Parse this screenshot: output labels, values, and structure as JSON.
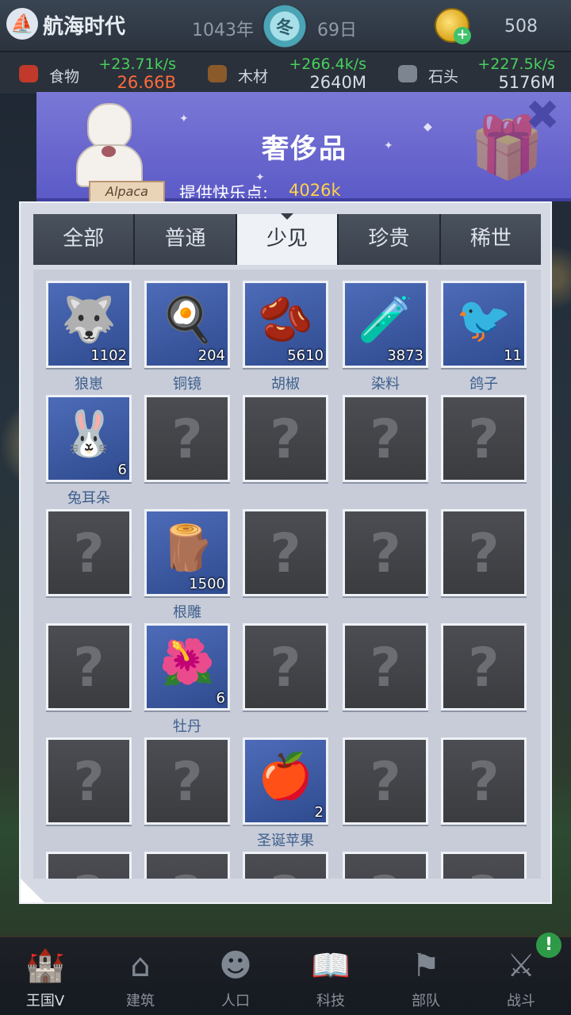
{
  "topbar": {
    "title": "航海时代",
    "year": "1043年",
    "season": "冬",
    "day": "69日",
    "coins": "508"
  },
  "resources": [
    {
      "name": "食物",
      "rate": "+23.71k/s",
      "total": "26.66B",
      "total_color": "#ff6a3a",
      "icon_color": "#c0392b"
    },
    {
      "name": "木材",
      "rate": "+266.4k/s",
      "total": "2640M",
      "total_color": "#d8dee6",
      "icon_color": "#8a5a2b"
    },
    {
      "name": "石头",
      "rate": "+227.5k/s",
      "total": "5176M",
      "total_color": "#d8dee6",
      "icon_color": "#7d8590"
    }
  ],
  "modal": {
    "mascot_sign": "Alpaca",
    "title": "奢侈品",
    "happy_label": "提供快乐点:",
    "happy_value": "4026k",
    "close_icon": "close-icon",
    "tabs": [
      {
        "label": "全部",
        "active": false
      },
      {
        "label": "普通",
        "active": false
      },
      {
        "label": "少见",
        "active": true
      },
      {
        "label": "珍贵",
        "active": false
      },
      {
        "label": "稀世",
        "active": false
      }
    ]
  },
  "items": [
    {
      "name": "狼崽",
      "count": "1102",
      "known": true,
      "icon": "wolf-cub-icon",
      "glyph": "🐺"
    },
    {
      "name": "铜镜",
      "count": "204",
      "known": true,
      "icon": "bronze-mirror-icon",
      "glyph": "🍳"
    },
    {
      "name": "胡椒",
      "count": "5610",
      "known": true,
      "icon": "pepper-icon",
      "glyph": "🫘"
    },
    {
      "name": "染料",
      "count": "3873",
      "known": true,
      "icon": "dye-bottle-icon",
      "glyph": "🧪"
    },
    {
      "name": "鸽子",
      "count": "11",
      "known": true,
      "icon": "pigeon-icon",
      "glyph": "🐦"
    },
    {
      "name": "兔耳朵",
      "count": "6",
      "known": true,
      "icon": "rabbit-ears-icon",
      "glyph": "🐰"
    },
    {
      "known": false
    },
    {
      "known": false
    },
    {
      "known": false
    },
    {
      "known": false
    },
    {
      "known": false
    },
    {
      "name": "根雕",
      "count": "1500",
      "known": true,
      "icon": "root-carving-icon",
      "glyph": "🪵"
    },
    {
      "known": false
    },
    {
      "known": false
    },
    {
      "known": false
    },
    {
      "known": false
    },
    {
      "name": "牡丹",
      "count": "6",
      "known": true,
      "icon": "peony-icon",
      "glyph": "🌺"
    },
    {
      "known": false
    },
    {
      "known": false
    },
    {
      "known": false
    },
    {
      "known": false
    },
    {
      "known": false
    },
    {
      "name": "圣诞苹果",
      "count": "2",
      "known": true,
      "icon": "christmas-apple-icon",
      "glyph": "🍎"
    },
    {
      "known": false
    },
    {
      "known": false
    },
    {
      "known": false
    },
    {
      "known": false
    },
    {
      "known": false
    },
    {
      "known": false
    },
    {
      "known": false
    }
  ],
  "unknown_mark": "?",
  "bottom_nav": [
    {
      "label": "王国V",
      "icon": "castle-icon",
      "glyph": "🏰",
      "active": true
    },
    {
      "label": "建筑",
      "icon": "house-icon",
      "glyph": "⌂",
      "active": false
    },
    {
      "label": "人口",
      "icon": "person-icon",
      "glyph": "☻",
      "active": false
    },
    {
      "label": "科技",
      "icon": "book-icon",
      "glyph": "📖",
      "active": false
    },
    {
      "label": "部队",
      "icon": "banner-icon",
      "glyph": "⚑",
      "active": false
    },
    {
      "label": "战斗",
      "icon": "swords-icon",
      "glyph": "⚔",
      "active": false
    }
  ],
  "nav_alert": "!"
}
